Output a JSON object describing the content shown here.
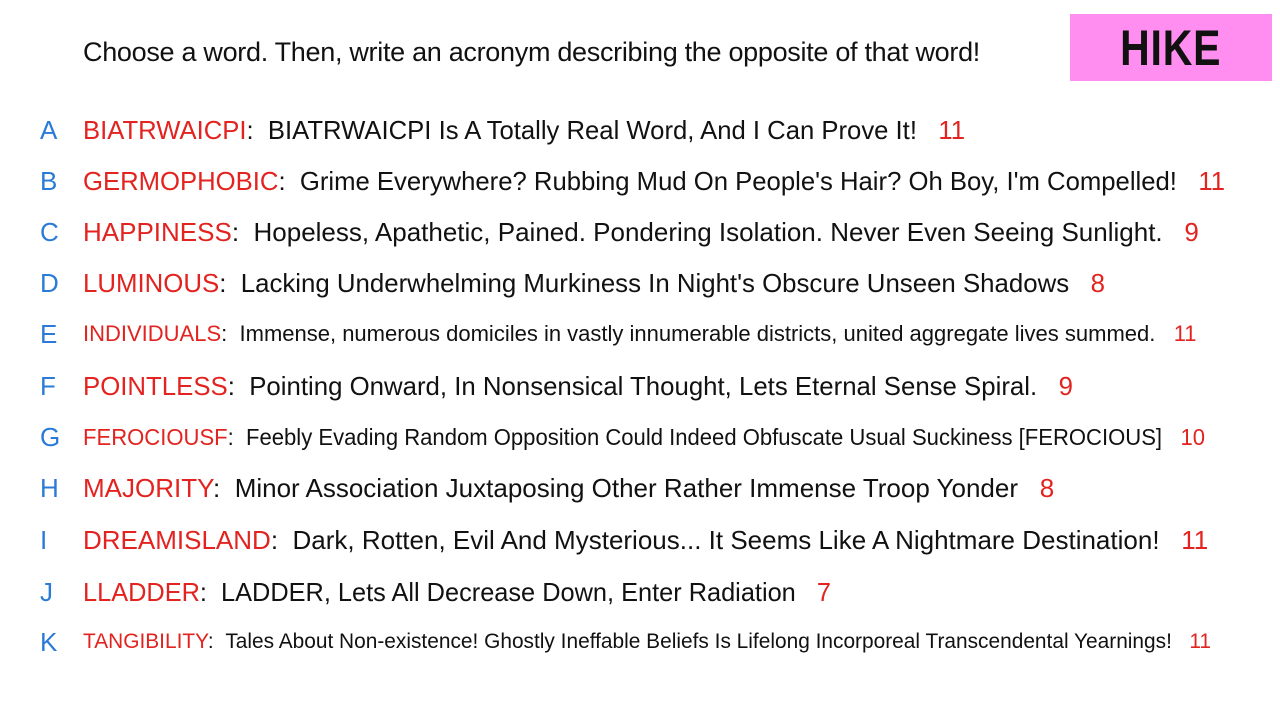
{
  "prompt": "Choose a word. Then, write an acronym describing the opposite of that word!",
  "tag": "HIKE",
  "colors": {
    "letter": "#2a7bd8",
    "word": "#e2231f",
    "score": "#e2231f",
    "text": "#111111",
    "tag_bg": "#ff8ef0"
  },
  "entries": [
    {
      "letter": "A",
      "word": "BIATRWAICPI",
      "acronym": "BIATRWAICPI Is A Totally Real Word, And I Can Prove It!",
      "score": "11"
    },
    {
      "letter": "B",
      "word": "GERMOPHOBIC",
      "acronym": "Grime Everywhere? Rubbing Mud On People's Hair? Oh Boy, I'm Compelled!",
      "score": "11"
    },
    {
      "letter": "C",
      "word": "HAPPINESS",
      "acronym": "Hopeless, Apathetic, Pained. Pondering Isolation. Never Even Seeing Sunlight.",
      "score": "9"
    },
    {
      "letter": "D",
      "word": "LUMINOUS",
      "acronym": "Lacking Underwhelming Murkiness In Night's Obscure Unseen Shadows",
      "score": "8"
    },
    {
      "letter": "E",
      "word": "INDIVIDUALS",
      "acronym": "Immense, numerous domiciles in vastly innumerable districts, united aggregate lives summed.",
      "score": "11"
    },
    {
      "letter": "F",
      "word": "POINTLESS",
      "acronym": "Pointing Onward, In Nonsensical Thought, Lets Eternal Sense Spiral.",
      "score": "9"
    },
    {
      "letter": "G",
      "word": "FEROCIOUSF",
      "acronym": "Feebly Evading Random Opposition Could Indeed Obfuscate Usual Suckiness [FEROCIOUS]",
      "score": "10"
    },
    {
      "letter": "H",
      "word": "MAJORITY",
      "acronym": "Minor Association Juxtaposing Other Rather Immense Troop Yonder",
      "score": "8"
    },
    {
      "letter": "I",
      "word": "DREAMISLAND",
      "acronym": "Dark, Rotten, Evil And Mysterious... It Seems Like A Nightmare Destination!",
      "score": "11"
    },
    {
      "letter": "J",
      "word": "LLADDER",
      "acronym": "LADDER, Lets All Decrease Down, Enter Radiation",
      "score": "7"
    },
    {
      "letter": "K",
      "word": "TANGIBILITY",
      "acronym": "Tales About Non-existence! Ghostly Ineffable Beliefs Is Lifelong Incorporeal Transcendental Yearnings!",
      "score": "11"
    }
  ]
}
